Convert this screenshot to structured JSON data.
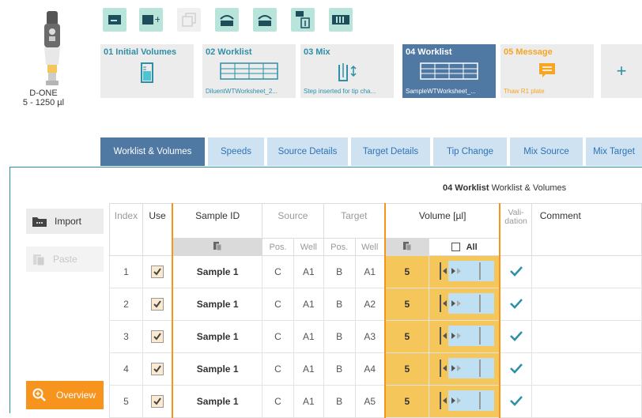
{
  "device": {
    "name": "D-ONE",
    "range": "5 - 1250 µl"
  },
  "toolbar": {
    "buttons": [
      {
        "name": "tool-card-icon",
        "disabled": false
      },
      {
        "name": "tool-add-icon",
        "disabled": false
      },
      {
        "name": "tool-copy-icon",
        "disabled": true
      },
      {
        "name": "tool-move-left-icon",
        "disabled": false
      },
      {
        "name": "tool-move-right-icon",
        "disabled": false
      },
      {
        "name": "tool-delete-icon",
        "disabled": false
      },
      {
        "name": "tool-tip-icon",
        "disabled": false
      }
    ]
  },
  "steps": [
    {
      "title": "01 Initial Volumes",
      "subtitle": "",
      "icon": "tube-icon"
    },
    {
      "title": "02 Worklist",
      "subtitle": "DiluentWTWorksheet_2...",
      "icon": "worklist-icon"
    },
    {
      "title": "03 Mix",
      "subtitle": "Step inserted for tip cha...",
      "icon": "mix-icon"
    },
    {
      "title": "04 Worklist",
      "subtitle": "SampleWTWorksheet_...",
      "icon": "worklist-icon",
      "active": true
    },
    {
      "title": "05 Message",
      "subtitle": "Thaw R1 plate",
      "icon": "message-icon"
    }
  ],
  "add_step_label": "+",
  "tabs": [
    "Worklist & Volumes",
    "Speeds",
    "Source Details",
    "Target Details",
    "Tip Change",
    "Mix Source",
    "Mix Target"
  ],
  "panel_title": {
    "step": "04 Worklist",
    "section": "Worklist & Volumes"
  },
  "side": {
    "import": "Import",
    "paste": "Paste",
    "overview": "Overview"
  },
  "table": {
    "headers": {
      "index": "Index",
      "use": "Use",
      "sample_id": "Sample ID",
      "source": "Source",
      "target": "Target",
      "volume": "Volume [µl]",
      "validation": "Vali-\ndation",
      "comment": "Comment"
    },
    "subheaders": {
      "pos": "Pos.",
      "well": "Well",
      "all": "All"
    },
    "rows": [
      {
        "index": "1",
        "sample": "Sample 1",
        "src_pos": "C",
        "src_well": "A1",
        "tgt_pos": "B",
        "tgt_well": "A1",
        "volume": "5"
      },
      {
        "index": "2",
        "sample": "Sample 1",
        "src_pos": "C",
        "src_well": "A1",
        "tgt_pos": "B",
        "tgt_well": "A2",
        "volume": "5"
      },
      {
        "index": "3",
        "sample": "Sample 1",
        "src_pos": "C",
        "src_well": "A1",
        "tgt_pos": "B",
        "tgt_well": "A3",
        "volume": "5"
      },
      {
        "index": "4",
        "sample": "Sample 1",
        "src_pos": "C",
        "src_well": "A1",
        "tgt_pos": "B",
        "tgt_well": "A4",
        "volume": "5"
      },
      {
        "index": "5",
        "sample": "Sample 1",
        "src_pos": "C",
        "src_well": "A1",
        "tgt_pos": "B",
        "tgt_well": "A5",
        "volume": "5"
      }
    ]
  },
  "colors": {
    "accent": "#2d8fa8",
    "orange": "#f7941d",
    "volume": "#f5c65a",
    "tab": "#cfe2f2",
    "active": "#4f78a3"
  }
}
